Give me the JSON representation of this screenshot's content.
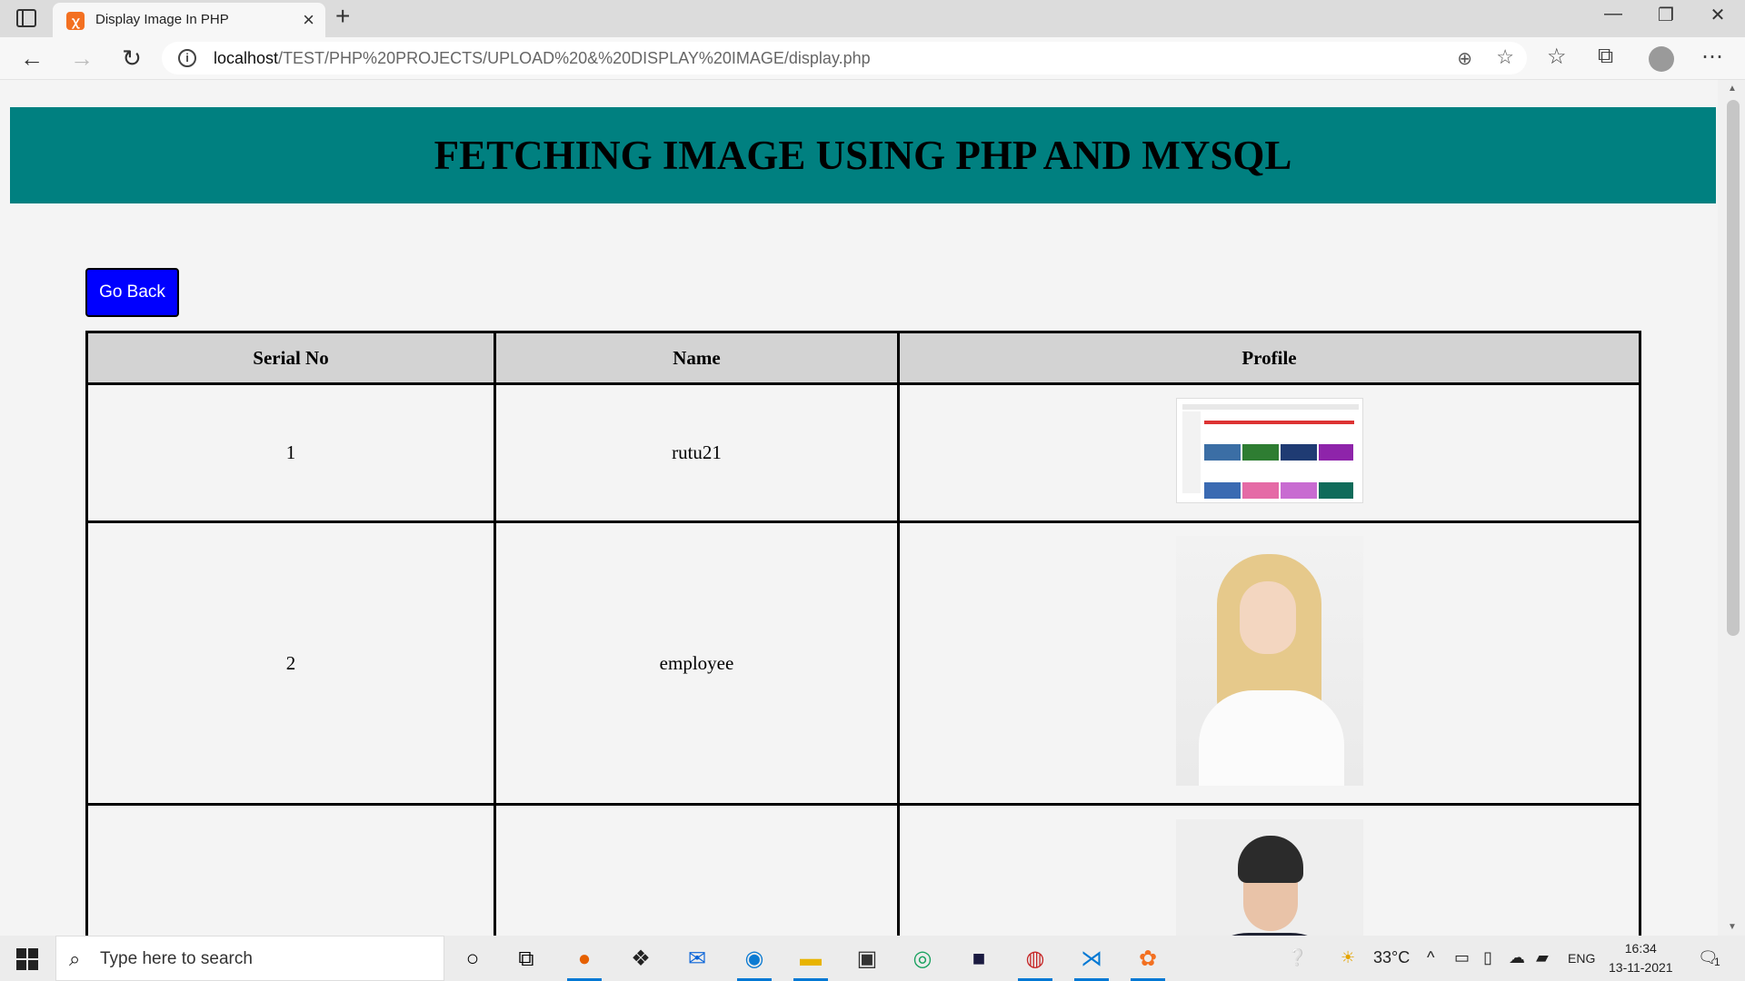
{
  "browser": {
    "tab_title": "Display Image In PHP",
    "url_host": "localhost",
    "url_path": "/TEST/PHP%20PROJECTS/UPLOAD%20&%20DISPLAY%20IMAGE/display.php"
  },
  "page": {
    "banner_title": "FETCHING IMAGE USING PHP AND MYSQL",
    "go_back_label": "Go Back",
    "table": {
      "headers": [
        "Serial No",
        "Name",
        "Profile"
      ],
      "rows": [
        {
          "serial": "1",
          "name": "rutu21"
        },
        {
          "serial": "2",
          "name": "employee"
        },
        {
          "serial": "",
          "name": ""
        }
      ]
    }
  },
  "taskbar": {
    "search_placeholder": "Type here to search",
    "weather": "33°C",
    "language": "ENG",
    "time": "16:34",
    "date": "13-11-2021",
    "notification_count": "1"
  },
  "colors": {
    "banner": "#008080",
    "button": "#0000ff",
    "header_cell": "#d3d3d3"
  }
}
